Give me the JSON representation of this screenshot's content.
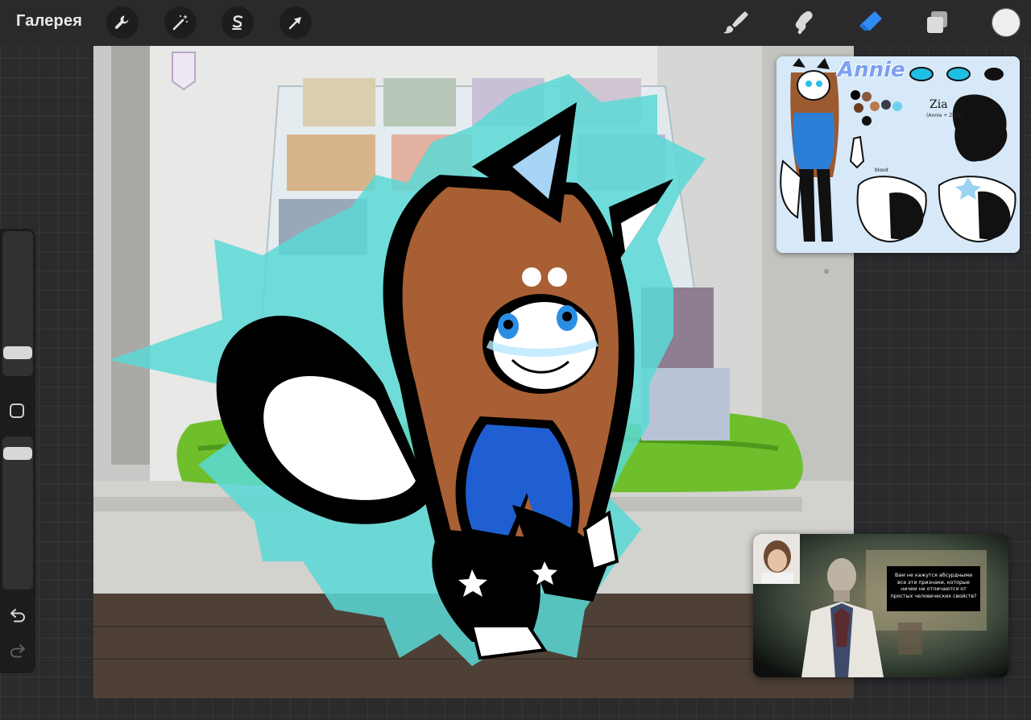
{
  "app": {
    "gallery_label": "Галерея"
  },
  "toolbar": {
    "left_tools": [
      {
        "name": "actions",
        "icon": "wrench-icon"
      },
      {
        "name": "adjustments",
        "icon": "magic-wand-icon"
      },
      {
        "name": "selection",
        "icon": "selection-s-icon"
      },
      {
        "name": "transform",
        "icon": "arrow-cursor-icon"
      }
    ],
    "right_tools": [
      {
        "name": "brush",
        "icon": "brush-icon"
      },
      {
        "name": "smudge",
        "icon": "smudge-icon"
      },
      {
        "name": "eraser",
        "icon": "eraser-icon",
        "active": true
      },
      {
        "name": "layers",
        "icon": "layers-icon"
      }
    ],
    "active_color": "#eeeeee",
    "active_tool_color": "#2f8bf5"
  },
  "sidebar": {
    "brush_size_level": 0.25,
    "opacity_level": 0.85,
    "undo_icon": "undo-icon",
    "redo_icon": "redo-icon"
  },
  "reference": {
    "title": "Annie",
    "subtitle": "Zia",
    "subtitle_note": "(Annie + Zoro)",
    "label": "blood"
  },
  "video": {
    "caption": "Вам не кажутся абсурдными все эти признаки, которые ничем не отличаются от простых человеческих свойств?"
  }
}
